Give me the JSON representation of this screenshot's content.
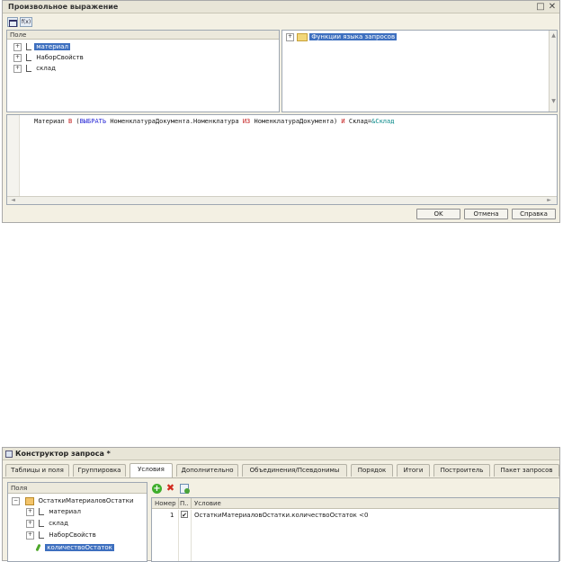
{
  "dialog1": {
    "title": "Произвольное выражение",
    "toolbar": {
      "btn1": "",
      "btn2": "f(x)"
    },
    "fields_pane": {
      "header": "Поле",
      "items": [
        {
          "label": "материал"
        },
        {
          "label": "НаборСвойств"
        },
        {
          "label": "склад"
        }
      ]
    },
    "functions_pane": {
      "items": [
        {
          "label": "Функции языка запросов"
        }
      ]
    },
    "expression": {
      "t1": "Материал ",
      "t2": "В",
      "t3": " (",
      "t4": "ВЫБРАТЬ",
      "t5": " НоменклатураДокумента.Номенклатура ",
      "t6": "ИЗ",
      "t7": " НоменклатураДокумента) ",
      "t8": "И",
      "t9": " Склад=",
      "t10": "&Склад"
    },
    "buttons": {
      "ok": "OK",
      "cancel": "Отмена",
      "help": "Справка"
    },
    "colors": {
      "keyword": "#2b2bd6",
      "operator": "#c21717",
      "param": "#0a8a8a",
      "selection": "#3d6fbf"
    }
  },
  "dialog2": {
    "title": "Конструктор запроса *",
    "tabs": [
      "Таблицы и поля",
      "Группировка",
      "Условия",
      "Дополнительно",
      "Объединения/Псевдонимы",
      "Порядок",
      "Итоги",
      "Построитель",
      "Пакет запросов"
    ],
    "active_tab": "Условия",
    "fields_pane": {
      "header": "Поля",
      "root": "ОстаткиМатериаловОстатки",
      "children": [
        {
          "label": "материал"
        },
        {
          "label": "склад"
        },
        {
          "label": "НаборСвойств"
        },
        {
          "label": "количествоОстаток"
        }
      ]
    },
    "conditions": {
      "headers": {
        "number": "Номер",
        "p": "П..",
        "condition": "Условие"
      },
      "rows": [
        {
          "number": "1",
          "checked": "✔",
          "condition": "ОстаткиМатериаловОстатки.количествоОстаток <0"
        }
      ]
    }
  }
}
